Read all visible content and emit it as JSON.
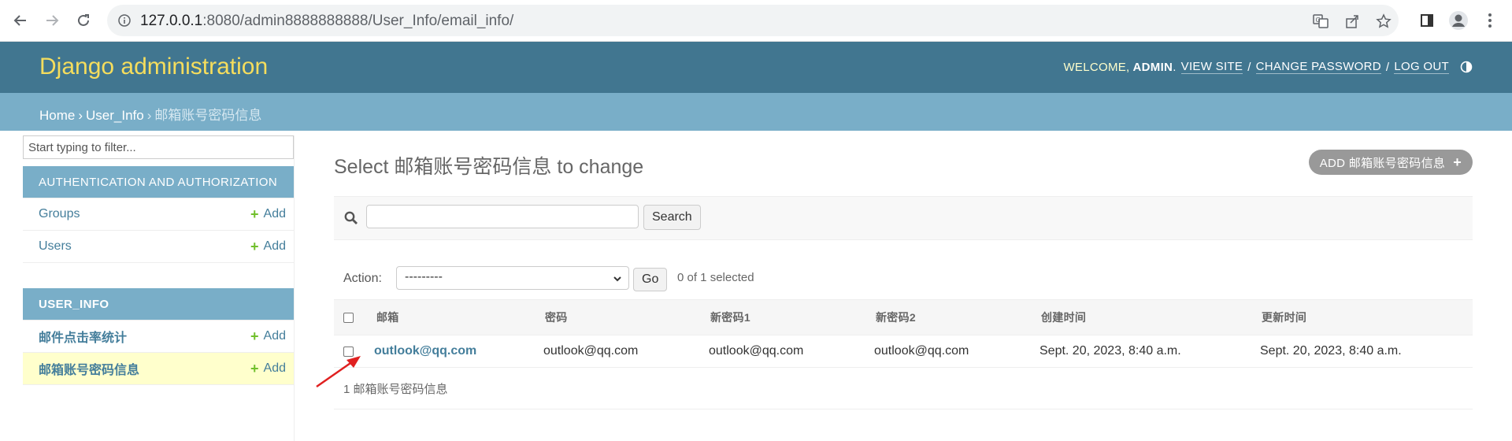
{
  "browser": {
    "url_host": "127.0.0.1",
    "url_rest": ":8080/admin8888888888/User_Info/email_info/"
  },
  "header": {
    "branding": "Django administration",
    "welcome": "WELCOME,",
    "username": "ADMIN",
    "view_site": "VIEW SITE",
    "change_password": "CHANGE PASSWORD",
    "log_out": "LOG OUT"
  },
  "breadcrumbs": {
    "home": "Home",
    "app": "User_Info",
    "current": "邮箱账号密码信息"
  },
  "sidebar": {
    "filter_placeholder": "Start typing to filter...",
    "modules": [
      {
        "caption": "AUTHENTICATION AND AUTHORIZATION",
        "models": [
          {
            "name": "Groups",
            "add": "Add"
          },
          {
            "name": "Users",
            "add": "Add"
          }
        ]
      },
      {
        "caption": "USER_INFO",
        "models": [
          {
            "name": "邮件点击率统计",
            "add": "Add"
          },
          {
            "name": "邮箱账号密码信息",
            "add": "Add",
            "current": true
          }
        ]
      }
    ]
  },
  "content": {
    "title": "Select 邮箱账号密码信息 to change",
    "add_button": "ADD 邮箱账号密码信息",
    "search_button": "Search",
    "search_value": "",
    "action_label": "Action:",
    "action_selected": "---------",
    "go_button": "Go",
    "selection_count": "0 of 1 selected",
    "columns": [
      "邮箱",
      "密码",
      "新密码1",
      "新密码2",
      "创建时间",
      "更新时间"
    ],
    "rows": [
      [
        "outlook@qq.com",
        "outlook@qq.com",
        "outlook@qq.com",
        "outlook@qq.com",
        "Sept. 20, 2023, 8:40 a.m.",
        "Sept. 20, 2023, 8:40 a.m."
      ]
    ],
    "paginator": "1 邮箱账号密码信息"
  },
  "colors": {
    "header_bg": "#417690",
    "breadcrumb_bg": "#79aec8",
    "branding": "#f5dd5d",
    "link": "#447e9b",
    "add_plus": "#70bf2b",
    "annotation_arrow": "#e02020"
  }
}
